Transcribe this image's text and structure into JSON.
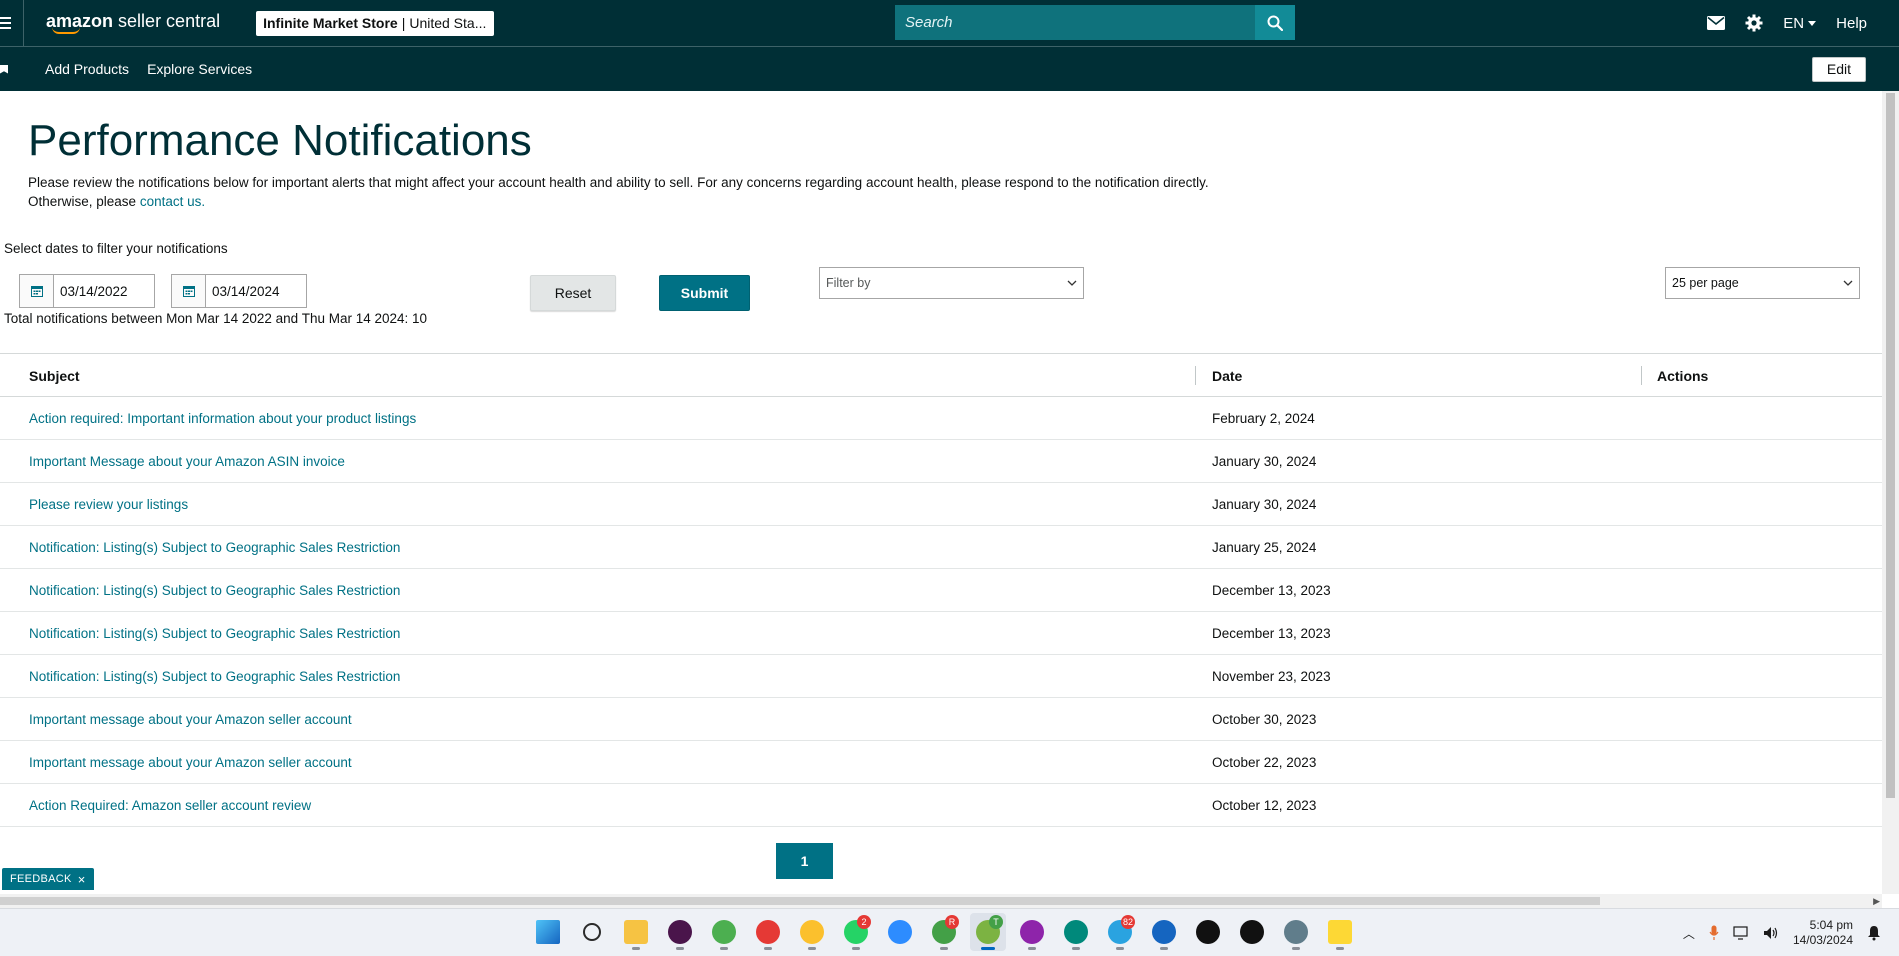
{
  "header": {
    "logo_brand": "amazon",
    "logo_product": "seller central",
    "store_name": "Infinite Market Store",
    "store_region": "United Sta...",
    "search_placeholder": "Search",
    "language": "EN",
    "help": "Help"
  },
  "subnav": {
    "items": [
      "Add Products",
      "Explore Services"
    ],
    "edit_label": "Edit"
  },
  "page": {
    "title": "Performance Notifications",
    "intro_text": "Please review the notifications below for important alerts that might affect your account health and ability to sell. For any concerns regarding account health, please respond to the notification directly. Otherwise, please ",
    "intro_link": "contact us.",
    "filter_label": "Select dates to filter your notifications",
    "date_from": "03/14/2022",
    "date_to": "03/14/2024",
    "reset_label": "Reset",
    "submit_label": "Submit",
    "filter_by_placeholder": "Filter by",
    "per_page": "25 per page",
    "total_text": "Total notifications between Mon Mar 14 2022 and Thu Mar 14 2024: 10"
  },
  "table": {
    "columns": [
      "Subject",
      "Date",
      "Actions"
    ],
    "rows": [
      {
        "subject": "Action required: Important information about your product listings",
        "date": "February 2, 2024"
      },
      {
        "subject": "Important Message about your Amazon ASIN invoice",
        "date": "January 30, 2024"
      },
      {
        "subject": "Please review your listings",
        "date": "January 30, 2024"
      },
      {
        "subject": "Notification: Listing(s) Subject to Geographic Sales Restriction",
        "date": "January 25, 2024"
      },
      {
        "subject": "Notification: Listing(s) Subject to Geographic Sales Restriction",
        "date": "December 13, 2023"
      },
      {
        "subject": "Notification: Listing(s) Subject to Geographic Sales Restriction",
        "date": "December 13, 2023"
      },
      {
        "subject": "Notification: Listing(s) Subject to Geographic Sales Restriction",
        "date": "November 23, 2023"
      },
      {
        "subject": "Important message about your Amazon seller account",
        "date": "October 30, 2023"
      },
      {
        "subject": "Important message about your Amazon seller account",
        "date": "October 22, 2023"
      },
      {
        "subject": "Action Required: Amazon seller account review",
        "date": "October 12, 2023"
      }
    ]
  },
  "pagination": {
    "current_page": "1"
  },
  "feedback": {
    "label": "FEEDBACK",
    "close": "×"
  },
  "taskbar": {
    "icons": [
      {
        "name": "windows-start-icon",
        "color": "#1e88e5",
        "badge": ""
      },
      {
        "name": "search-icon",
        "color": "#2b2b2b",
        "badge": ""
      },
      {
        "name": "file-explorer-icon",
        "color": "#f6c343",
        "badge": ""
      },
      {
        "name": "slack-icon",
        "color": "#4a154b",
        "badge": ""
      },
      {
        "name": "chrome-icon",
        "color": "#4caf50",
        "badge": ""
      },
      {
        "name": "chrome-icon",
        "color": "#e53935",
        "badge": ""
      },
      {
        "name": "chrome-icon",
        "color": "#fbc02d",
        "badge": ""
      },
      {
        "name": "whatsapp-icon",
        "color": "#25d366",
        "badge": "2"
      },
      {
        "name": "zoom-icon",
        "color": "#2d8cff",
        "badge": ""
      },
      {
        "name": "chrome-icon",
        "color": "#43a047",
        "badge": "R"
      },
      {
        "name": "chrome-icon",
        "color": "#7cb342",
        "badge": "T"
      },
      {
        "name": "chrome-icon",
        "color": "#8e24aa",
        "badge": ""
      },
      {
        "name": "chrome-icon",
        "color": "#00897b",
        "badge": ""
      },
      {
        "name": "telegram-icon",
        "color": "#2aa3e0",
        "badge": "82"
      },
      {
        "name": "remote-app-icon",
        "color": "#1565c0",
        "badge": ""
      },
      {
        "name": "capcut-icon",
        "color": "#111111",
        "badge": ""
      },
      {
        "name": "capcut-icon",
        "color": "#111111",
        "badge": ""
      },
      {
        "name": "app-icon",
        "color": "#607d8b",
        "badge": ""
      },
      {
        "name": "sticky-notes-icon",
        "color": "#fdd835",
        "badge": ""
      }
    ],
    "time": "5:04 pm",
    "date": "14/03/2024"
  },
  "colors": {
    "header_bg": "#002f36",
    "link": "#007185",
    "primary_button": "#007185",
    "search_bg": "#0f727c"
  }
}
